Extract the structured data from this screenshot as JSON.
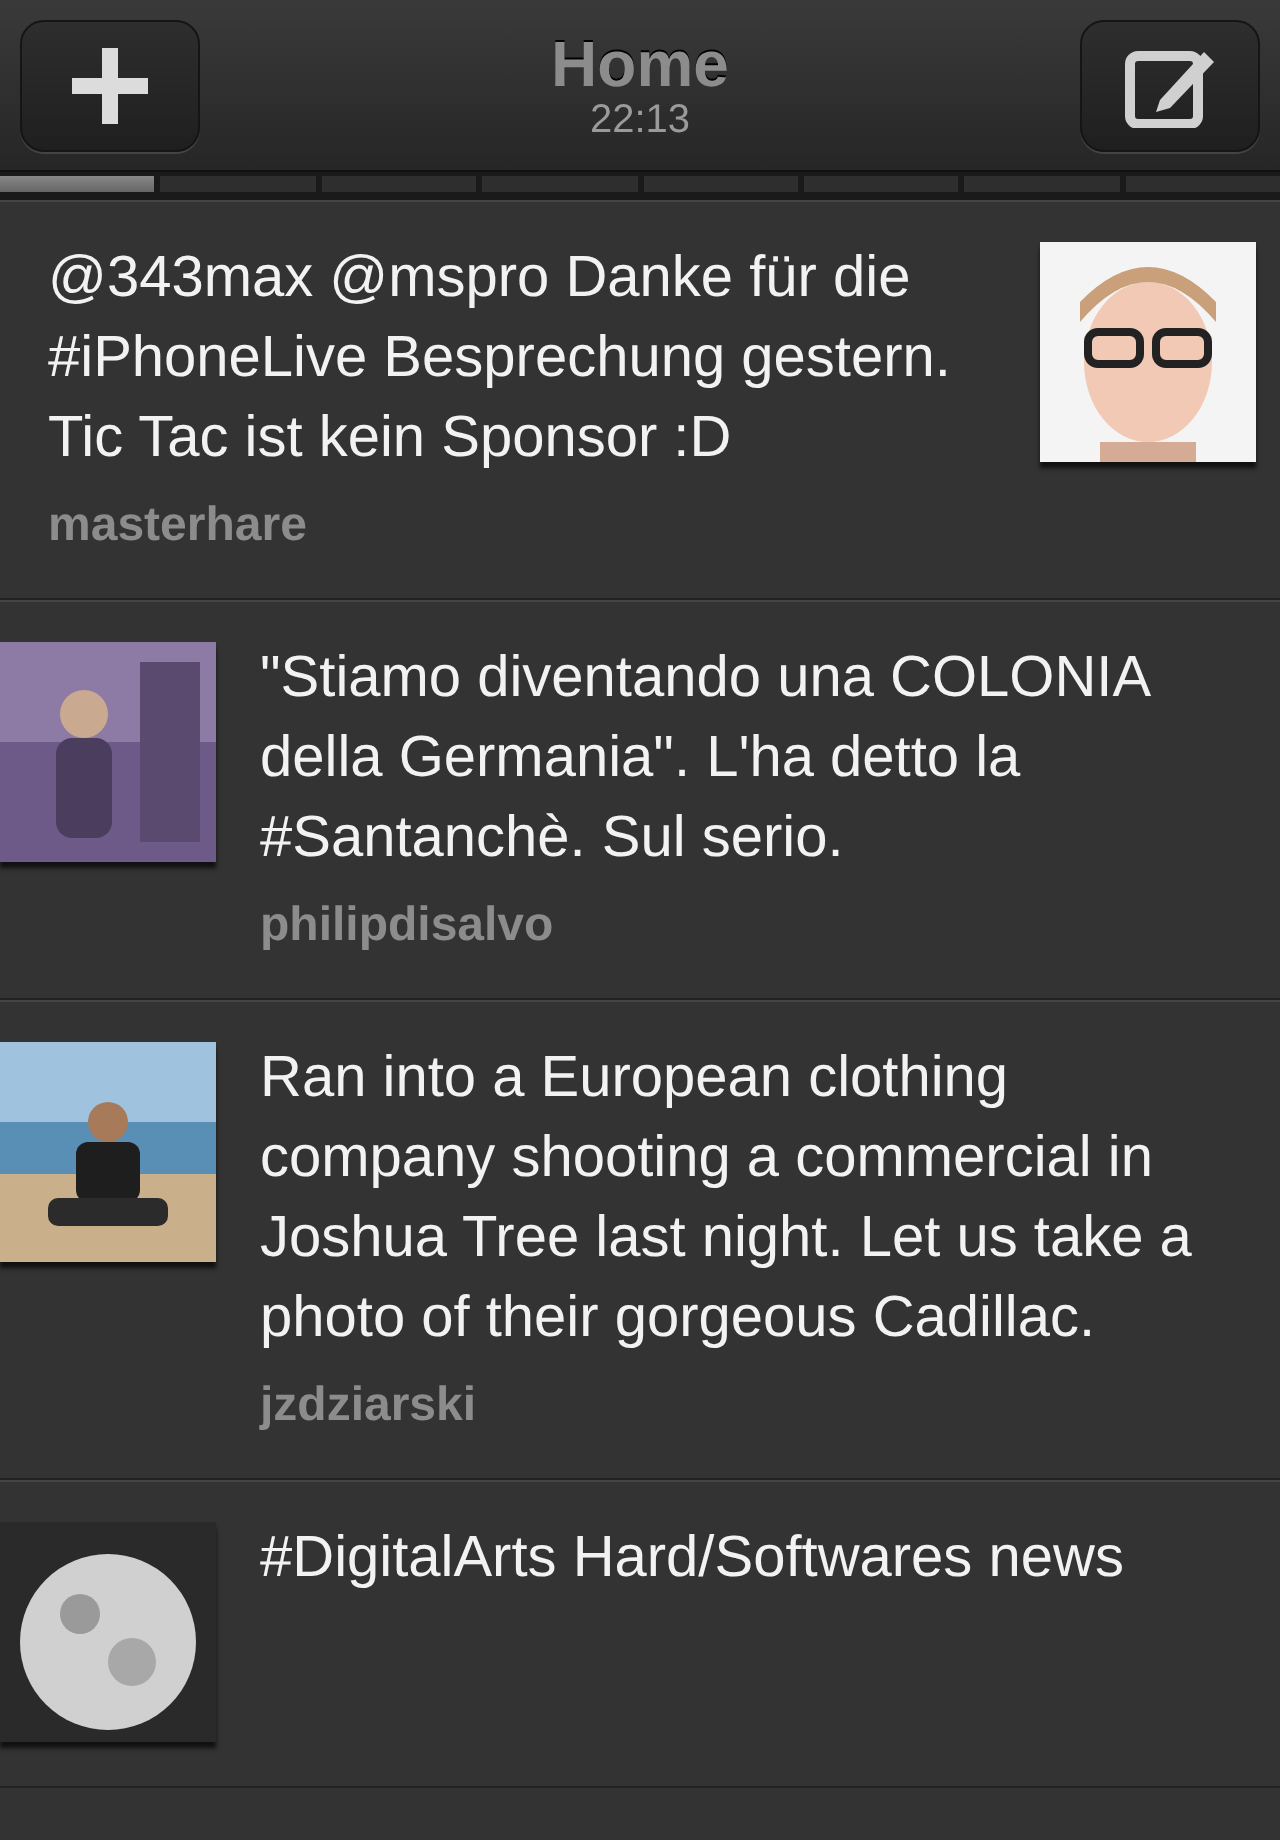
{
  "header": {
    "title": "Home",
    "time": "22:13"
  },
  "pages": [
    {
      "selected": true
    },
    {
      "selected": false
    },
    {
      "selected": false
    },
    {
      "selected": false
    },
    {
      "selected": false
    },
    {
      "selected": false
    },
    {
      "selected": false
    },
    {
      "selected": false
    }
  ],
  "tweets": [
    {
      "text": "@343max @mspro Danke für die #iPhoneLive Besprechung gestern. Tic Tac ist kein Sponsor :D",
      "user": "masterhare",
      "kind": "mine"
    },
    {
      "text": "\"Stiamo diventando una COLONIA della Germania\". L'ha detto la #Santanchè. Sul serio.",
      "user": "philipdisalvo",
      "kind": "other"
    },
    {
      "text": "Ran into a European clothing company shooting a commercial in Joshua Tree last night. Let us take a photo of their gorgeous Cadillac.",
      "user": "jzdziarski",
      "kind": "other"
    },
    {
      "text": "#DigitalArts Hard/Softwares news",
      "kind": "other"
    }
  ]
}
